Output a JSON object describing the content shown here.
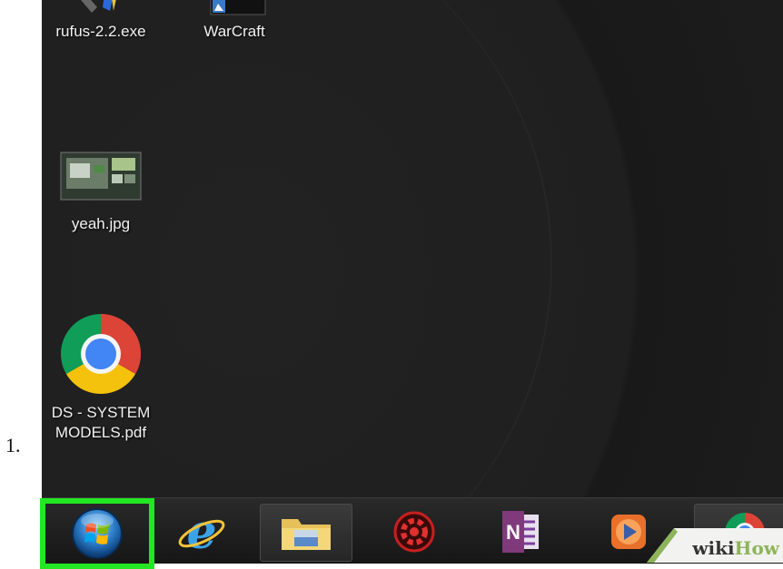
{
  "step": {
    "number": "1."
  },
  "desktop": {
    "icons": [
      {
        "label": "rufus-2.2.exe",
        "icon": "usb-drive-icon"
      },
      {
        "label": "WarCraft",
        "icon": "game-shortcut-icon"
      },
      {
        "label": "yeah.jpg",
        "icon": "image-thumbnail-icon"
      },
      {
        "label_line1": "DS - SYSTEM",
        "label_line2": "MODELS.pdf",
        "icon": "chrome-icon"
      }
    ]
  },
  "taskbar": {
    "items": [
      {
        "name": "start-button",
        "icon": "windows-orb-icon",
        "highlighted": true,
        "highlight_color": "#22e722"
      },
      {
        "name": "internet-explorer",
        "icon": "internet-explorer-icon"
      },
      {
        "name": "file-explorer",
        "icon": "folder-icon",
        "active": true
      },
      {
        "name": "settings-app",
        "icon": "red-gear-icon"
      },
      {
        "name": "onenote",
        "icon": "onenote-icon",
        "glyph": "N"
      },
      {
        "name": "media-player",
        "icon": "media-player-icon"
      },
      {
        "name": "chrome",
        "icon": "chrome-icon",
        "active": true
      }
    ]
  },
  "watermark": {
    "wiki": "wiki",
    "how": "How"
  },
  "colors": {
    "highlight": "#22e722",
    "desktop": "#1f1f1f",
    "taskbar": "#1c1c1c"
  }
}
